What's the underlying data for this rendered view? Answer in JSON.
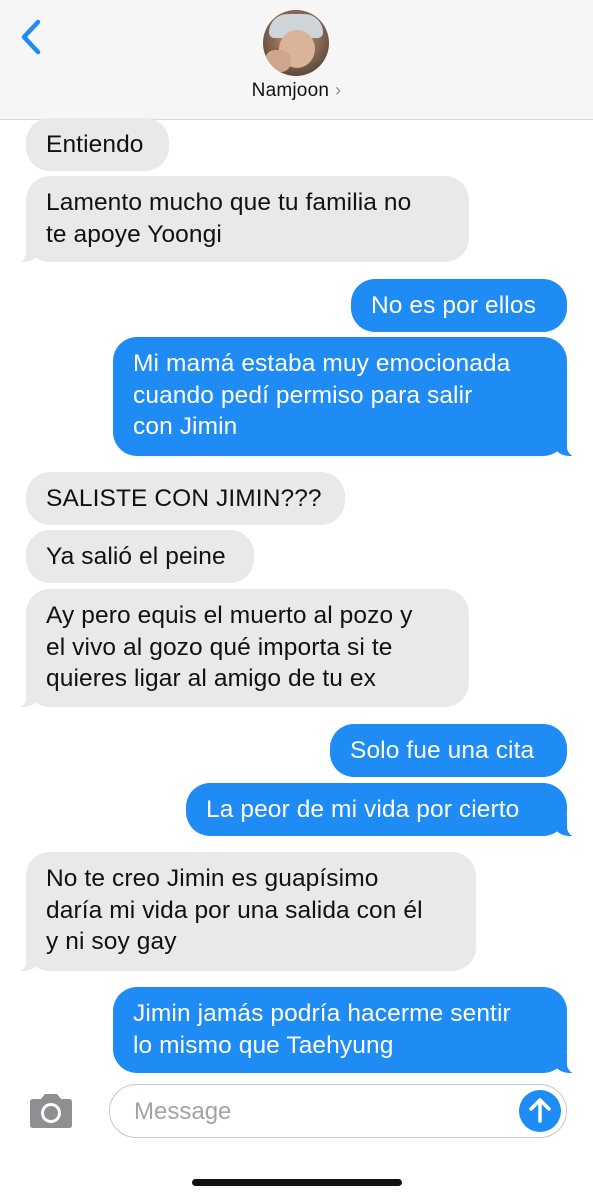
{
  "contact": {
    "name": "Namjoon",
    "chevron": "›"
  },
  "messages": [
    {
      "side": "in",
      "text": "Entiendo"
    },
    {
      "side": "in",
      "text": "Lamento mucho que tu familia no\nte apoye Yoongi"
    },
    {
      "side": "out",
      "text": "No es por ellos"
    },
    {
      "side": "out",
      "text": "Mi mamá estaba muy emocionada\ncuando pedí permiso para salir\ncon Jimin"
    },
    {
      "side": "in",
      "text": "SALISTE CON JIMIN???"
    },
    {
      "side": "in",
      "text": "Ya salió el peine"
    },
    {
      "side": "in",
      "text": "Ay pero equis el muerto al pozo y\nel vivo al gozo qué importa si te\nquieres ligar al amigo de tu ex"
    },
    {
      "side": "out",
      "text": "Solo fue una cita"
    },
    {
      "side": "out",
      "text": "La peor de mi vida por cierto"
    },
    {
      "side": "in",
      "text": "No te creo Jimin es guapísimo\ndaría mi vida por una salida con él\ny ni soy gay"
    },
    {
      "side": "out",
      "text": "Jimin jamás podría hacerme sentir\nlo mismo que Taehyung"
    }
  ],
  "composer": {
    "placeholder": "Message",
    "value": ""
  },
  "icons": {
    "back": "chevron-left-icon",
    "camera": "camera-icon",
    "send": "arrow-up-icon"
  },
  "colors": {
    "accent": "#1f8bf5",
    "incoming_bubble": "#e9e9eb",
    "header_bg": "#f6f6f6"
  }
}
